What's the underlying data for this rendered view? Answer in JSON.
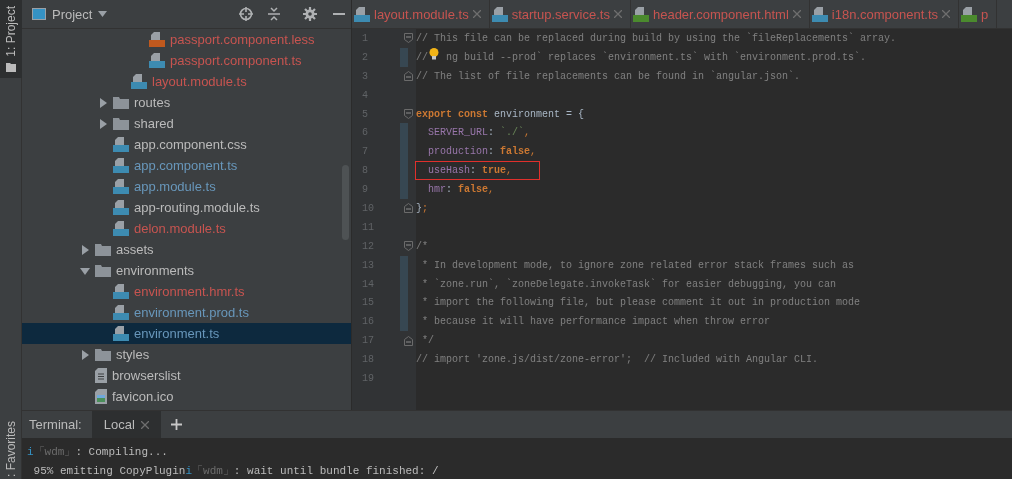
{
  "side_stripe": {
    "top_button": {
      "label": "1: Project",
      "selected": true
    },
    "bottom_button": {
      "label": ": Favorites",
      "selected": false
    }
  },
  "project_panel": {
    "title": "Project",
    "tree": [
      {
        "children": [
          {
            "children": [
              {
                "children": [
                  {
                    "label": "passport.component.less",
                    "kind": "less",
                    "color": "#c75450",
                    "selected": false
                  },
                  {
                    "label": "passport.component.ts",
                    "kind": "ts",
                    "color": "#c75450",
                    "selected": false
                  }
                ]
              },
              {
                "label": "layout.module.ts",
                "kind": "ts",
                "color": "#c75450",
                "selected": false
              }
            ]
          },
          {
            "label": "routes",
            "kind": "folder",
            "expanded": false,
            "color": "#bbbbbb",
            "selected": false
          },
          {
            "label": "shared",
            "kind": "folder",
            "expanded": false,
            "color": "#bbbbbb",
            "selected": false
          },
          {
            "label": "app.component.css",
            "kind": "css",
            "color": "#bbbbbb",
            "selected": false
          },
          {
            "label": "app.component.ts",
            "kind": "ts",
            "color": "#6897bb",
            "selected": false
          },
          {
            "label": "app.module.ts",
            "kind": "ts",
            "color": "#6897bb",
            "selected": false
          },
          {
            "label": "app-routing.module.ts",
            "kind": "ts",
            "color": "#bbbbbb",
            "selected": false
          },
          {
            "label": "delon.module.ts",
            "kind": "ts",
            "color": "#c75450",
            "selected": false
          }
        ]
      },
      {
        "label": "assets",
        "kind": "folder",
        "expanded": false,
        "color": "#bbbbbb",
        "selected": false
      },
      {
        "label": "environments",
        "kind": "folder",
        "expanded": true,
        "color": "#bbbbbb",
        "selected": false,
        "children": [
          {
            "label": "environment.hmr.ts",
            "kind": "ts",
            "color": "#c75450",
            "selected": false
          },
          {
            "label": "environment.prod.ts",
            "kind": "ts",
            "color": "#6897bb",
            "selected": false
          },
          {
            "label": "environment.ts",
            "kind": "ts",
            "color": "#6897bb",
            "selected": true
          }
        ]
      },
      {
        "label": "styles",
        "kind": "folder",
        "expanded": false,
        "color": "#bbbbbb",
        "selected": false
      },
      {
        "label": "browserslist",
        "kind": "text",
        "color": "#bbbbbb",
        "selected": false
      },
      {
        "label": "favicon.ico",
        "kind": "image",
        "color": "#bbbbbb",
        "selected": false
      }
    ]
  },
  "editor": {
    "tabs": [
      {
        "label": "layout.module.ts",
        "kind": "ts",
        "color": "#c75450",
        "cut": false
      },
      {
        "label": "startup.service.ts",
        "kind": "ts",
        "color": "#c75450",
        "cut": false
      },
      {
        "label": "header.component.html",
        "kind": "html",
        "color": "#c75450",
        "cut": false
      },
      {
        "label": "i18n.component.ts",
        "kind": "ts",
        "color": "#c75450",
        "cut": false
      },
      {
        "label": "p",
        "kind": "html",
        "color": "#c75450",
        "cut": true
      }
    ],
    "lines": [
      {
        "number": "1",
        "kind": "opener",
        "changed": false,
        "boxed": false,
        "bulb": false,
        "tokens": [
          {
            "kind": "comment",
            "text": "// This file can be replaced during build by using the `fileReplacements` array."
          }
        ]
      },
      {
        "number": "2",
        "changed": true,
        "boxed": false,
        "bulb": true,
        "tokens": [
          {
            "kind": "comment",
            "text": "//"
          },
          {
            "kind": "comment",
            "text": " ng build --prod` replaces `environment.ts` with `environment.prod.ts`."
          }
        ]
      },
      {
        "number": "3",
        "kind": "closer",
        "changed": false,
        "boxed": false,
        "bulb": false,
        "tokens": [
          {
            "kind": "comment",
            "text": "// The list of file replacements can be found in `angular.json`."
          }
        ]
      },
      {
        "number": "4",
        "changed": false,
        "boxed": false,
        "bulb": false
      },
      {
        "number": "5",
        "kind": "opener",
        "changed": false,
        "boxed": false,
        "bulb": false,
        "tokens": [
          {
            "kind": "keyword",
            "text": "export const "
          },
          {
            "kind": "plain",
            "text": "environment = {"
          }
        ]
      },
      {
        "number": "6",
        "changed": true,
        "boxed": false,
        "bulb": false,
        "tokens": [
          {
            "kind": "property",
            "text": "  SERVER_URL"
          },
          {
            "kind": "plain",
            "text": ": "
          },
          {
            "kind": "string",
            "text": "`./`"
          },
          {
            "kind": "punct",
            "text": ","
          }
        ]
      },
      {
        "number": "7",
        "changed": true,
        "boxed": false,
        "bulb": false,
        "tokens": [
          {
            "kind": "property",
            "text": "  production"
          },
          {
            "kind": "plain",
            "text": ": "
          },
          {
            "kind": "keyword",
            "text": "false"
          },
          {
            "kind": "punct",
            "text": ","
          }
        ]
      },
      {
        "number": "8",
        "changed": true,
        "boxed": true,
        "bulb": false,
        "tokens": [
          {
            "kind": "property",
            "text": "  useHash"
          },
          {
            "kind": "plain",
            "text": ": "
          },
          {
            "kind": "keyword",
            "text": "true"
          },
          {
            "kind": "punct",
            "text": ","
          }
        ]
      },
      {
        "number": "9",
        "changed": true,
        "boxed": false,
        "bulb": false,
        "tokens": [
          {
            "kind": "property",
            "text": "  hmr"
          },
          {
            "kind": "plain",
            "text": ": "
          },
          {
            "kind": "keyword",
            "text": "false"
          },
          {
            "kind": "punct",
            "text": ","
          }
        ]
      },
      {
        "number": "10",
        "kind": "closer",
        "changed": false,
        "boxed": false,
        "bulb": false,
        "tokens": [
          {
            "kind": "plain",
            "text": "}"
          },
          {
            "kind": "punct",
            "text": ";"
          }
        ]
      },
      {
        "number": "11",
        "changed": false,
        "boxed": false,
        "bulb": false
      },
      {
        "number": "12",
        "kind": "opener",
        "changed": false,
        "boxed": false,
        "bulb": false,
        "tokens": [
          {
            "kind": "comment",
            "text": "/*"
          }
        ]
      },
      {
        "number": "13",
        "changed": true,
        "boxed": false,
        "bulb": false,
        "tokens": [
          {
            "kind": "comment",
            "text": " * In development mode, to ignore zone related error stack frames such as"
          }
        ]
      },
      {
        "number": "14",
        "changed": true,
        "boxed": false,
        "bulb": false,
        "tokens": [
          {
            "kind": "comment",
            "text": " * `zone.run`, `zoneDelegate.invokeTask` for easier debugging, you can"
          }
        ]
      },
      {
        "number": "15",
        "changed": true,
        "boxed": false,
        "bulb": false,
        "tokens": [
          {
            "kind": "comment",
            "text": " * import the following file, but please comment it out in production mode"
          }
        ]
      },
      {
        "number": "16",
        "changed": true,
        "boxed": false,
        "bulb": false,
        "tokens": [
          {
            "kind": "comment",
            "text": " * because it will have performance impact when throw error"
          }
        ]
      },
      {
        "number": "17",
        "kind": "closer",
        "changed": false,
        "boxed": false,
        "bulb": false,
        "tokens": [
          {
            "kind": "comment",
            "text": " */"
          }
        ]
      },
      {
        "number": "18",
        "changed": false,
        "boxed": false,
        "bulb": false,
        "tokens": [
          {
            "kind": "comment",
            "text": "// import 'zone.js/dist/zone-error';  // Included with Angular CLI."
          }
        ]
      },
      {
        "number": "19",
        "changed": false,
        "boxed": false,
        "bulb": false
      }
    ]
  },
  "terminal": {
    "title": "Terminal:",
    "tabs": [
      {
        "label": "Local",
        "selected": true
      }
    ],
    "lines": [
      [
        {
          "kind": "info",
          "text": "i"
        },
        {
          "kind": "dim",
          "text": "「wdm」"
        },
        {
          "kind": "plain",
          "text": ": Compiling..."
        }
      ],
      [
        {
          "kind": "plain",
          "text": " 95% emitting CopyPlugin"
        },
        {
          "kind": "info",
          "text": "i"
        },
        {
          "kind": "dim",
          "text": "「wdm」"
        },
        {
          "kind": "plain",
          "text": ": wait until bundle finished: /"
        }
      ]
    ]
  }
}
